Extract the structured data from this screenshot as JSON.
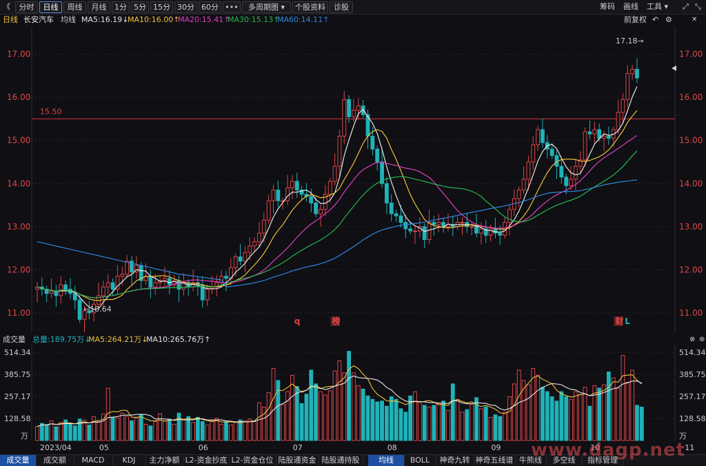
{
  "toolbar": {
    "back_icon": "《",
    "left_tabs": [
      "分时",
      "日线",
      "周线",
      "月线",
      "1分",
      "5分",
      "15分",
      "30分",
      "60分",
      "•••",
      "多周期图 ▾",
      "个股资料",
      "诊股"
    ],
    "active_tab": "日线",
    "right_items": [
      "筹码",
      "画线",
      "工具 ▾"
    ],
    "window_icons": [
      "expand-icon",
      "collapse-icon"
    ]
  },
  "infobar": {
    "period": "日线",
    "stock_name": "长安汽车",
    "indicator": "均线",
    "ma5": "MA5:16.19↓",
    "ma10": "MA10:16.00↑",
    "ma20": "MA20:15.41↑",
    "ma30": "MA30:15.13↑",
    "ma60": "MA60:14.11↑",
    "adjust": "前复权"
  },
  "colors": {
    "up": "#e04646",
    "down": "#1fb3b8",
    "ma5": "#e8e8e8",
    "ma10": "#f0c23c",
    "ma20": "#e040c0",
    "ma30": "#28b84e",
    "ma60": "#2f86e0",
    "hline": "#c0303a",
    "grid": "#2a2a2a"
  },
  "chart_data": [
    {
      "type": "candlestick",
      "title": "长安汽车 日线",
      "y_ticks": [
        "17.00",
        "16.00",
        "15.00",
        "14.00",
        "13.00",
        "12.00",
        "11.00"
      ],
      "ylim": [
        10.55,
        17.65
      ],
      "annotations": {
        "high": "17.18→",
        "low": "←10.64",
        "hline_label": "15.50",
        "hline_value": 15.5
      },
      "markers": [
        {
          "label": "q",
          "index": 55
        },
        {
          "label": "榜",
          "index": 63
        },
        {
          "label": "财",
          "index": 123
        },
        {
          "label": "L",
          "index": 125
        }
      ],
      "close": [
        11.6,
        11.55,
        11.45,
        11.5,
        11.4,
        11.65,
        11.55,
        11.45,
        11.3,
        10.85,
        11.05,
        11.0,
        11.2,
        11.4,
        11.6,
        11.7,
        11.55,
        11.85,
        11.9,
        12.2,
        11.95,
        12.1,
        11.75,
        11.85,
        11.6,
        11.7,
        11.75,
        11.8,
        11.65,
        11.75,
        11.55,
        11.7,
        11.6,
        11.7,
        11.65,
        11.3,
        11.55,
        11.6,
        11.7,
        11.85,
        11.8,
        12.05,
        12.3,
        12.2,
        12.4,
        12.55,
        12.65,
        12.85,
        13.15,
        13.6,
        13.85,
        13.6,
        13.6,
        13.9,
        14.05,
        13.85,
        13.75,
        13.7,
        13.55,
        13.3,
        13.4,
        13.75,
        14.05,
        14.4,
        15.1,
        15.95,
        15.55,
        15.7,
        15.8,
        15.6,
        15.1,
        14.8,
        14.5,
        14.0,
        13.55,
        13.3,
        13.25,
        13.1,
        12.95,
        12.9,
        12.9,
        13.0,
        12.7,
        13.1,
        13.05,
        13.1,
        13.0,
        13.05,
        13.0,
        13.1,
        13.1,
        13.0,
        13.0,
        12.85,
        12.95,
        12.8,
        12.95,
        12.85,
        12.8,
        13.1,
        13.4,
        13.65,
        13.85,
        14.1,
        14.5,
        14.9,
        15.25,
        14.95,
        14.8,
        14.65,
        14.4,
        14.15,
        13.95,
        14.1,
        14.4,
        14.55,
        15.2,
        15.15,
        15.25,
        15.05,
        15.1,
        15.05,
        15.25,
        15.65,
        15.95,
        16.55,
        16.65,
        16.45
      ]
    },
    {
      "type": "bar",
      "title": "成交量",
      "total": "总量:189.75万↓",
      "ma5": "MA5:264.21万↓",
      "ma10": "MA10:265.76万↑",
      "y_ticks": [
        "514.34",
        "385.75",
        "257.17",
        "128.58",
        "万"
      ],
      "ylim": [
        0,
        514.34
      ],
      "x_labels": [
        {
          "label": "2023/04",
          "index": 0
        },
        {
          "label": "05",
          "index": 14
        },
        {
          "label": "06",
          "index": 35
        },
        {
          "label": "07",
          "index": 55
        },
        {
          "label": "08",
          "index": 75
        },
        {
          "label": "09",
          "index": 97
        },
        {
          "label": "10",
          "index": 118
        },
        {
          "label": "11",
          "index": 138
        }
      ],
      "values": [
        82,
        100,
        92,
        115,
        80,
        105,
        120,
        95,
        85,
        125,
        118,
        90,
        140,
        110,
        155,
        305,
        135,
        130,
        160,
        140,
        115,
        130,
        150,
        95,
        85,
        110,
        155,
        115,
        125,
        95,
        160,
        120,
        140,
        105,
        135,
        110,
        90,
        115,
        130,
        95,
        110,
        90,
        105,
        120,
        115,
        125,
        110,
        220,
        195,
        280,
        420,
        350,
        210,
        285,
        380,
        315,
        215,
        270,
        410,
        330,
        285,
        265,
        290,
        405,
        465,
        395,
        520,
        395,
        320,
        300,
        260,
        240,
        225,
        230,
        200,
        255,
        240,
        185,
        165,
        260,
        285,
        225,
        205,
        195,
        205,
        215,
        230,
        175,
        330,
        240,
        165,
        180,
        210,
        250,
        185,
        195,
        135,
        150,
        140,
        165,
        255,
        330,
        410,
        350,
        325,
        420,
        380,
        310,
        285,
        255,
        230,
        285,
        255,
        240,
        285,
        270,
        310,
        200,
        320,
        305,
        325,
        400,
        365,
        305,
        495,
        340,
        410,
        205,
        195
      ]
    }
  ],
  "bottom_tabs": [
    "成交量",
    "成交额",
    "MACD",
    "KDJ",
    "主力净额",
    "L2-资金抄底",
    "L2-资金仓位",
    "陆股通资金",
    "陆股通持股",
    "均线",
    "BOLL",
    "神奇九转",
    "神奇五线谱",
    "牛熊线",
    "多空线",
    "指标管理"
  ],
  "active_bottom_tabs": [
    "成交量",
    "均线"
  ],
  "watermark": "www.dagp.net"
}
